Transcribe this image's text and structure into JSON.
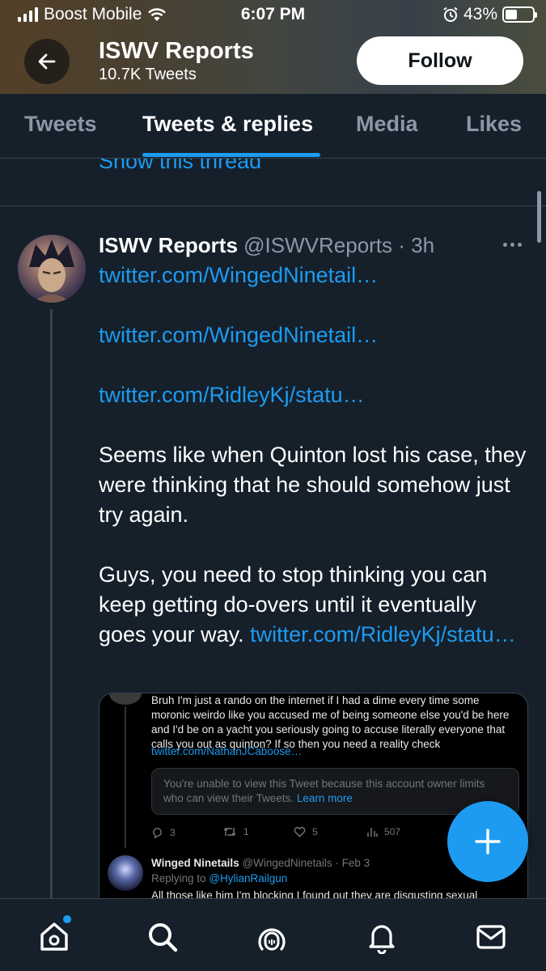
{
  "status_bar": {
    "carrier": "Boost Mobile",
    "time": "6:07 PM",
    "battery_percent": "43%",
    "battery_level": 0.43
  },
  "header": {
    "name": "ISWV Reports",
    "tweet_count": "10.7K Tweets",
    "follow_label": "Follow",
    "back_icon": "arrow-left-icon"
  },
  "tabs": [
    {
      "label": "Tweets",
      "active": false
    },
    {
      "label": "Tweets & replies",
      "active": true
    },
    {
      "label": "Media",
      "active": false
    },
    {
      "label": "Likes",
      "active": false
    }
  ],
  "timeline": {
    "show_thread": "Show this thread",
    "tweet": {
      "author": "ISWV Reports",
      "handle": "@ISWVReports",
      "separator": " · ",
      "time": "3h",
      "link1": "twitter.com/WingedNinetail…",
      "link2": "twitter.com/WingedNinetail…",
      "link3": "twitter.com/RidleyKj/statu…",
      "para1": "Seems like when Quinton lost his case, they were thinking that he should somehow just try again.",
      "para2": "Guys, you need to stop thinking you can keep getting do-overs until it eventually goes your way. ",
      "link4": "twitter.com/RidleyKj/statu…"
    },
    "embed": {
      "text": "Bruh I'm just a rando on the internet if I had a dime every time some moronic weirdo like you accused me of being someone else you'd be here and I'd be on a yacht you seriously going to accuse literally everyone that calls you out as quinton? If so then you need a reality check",
      "link": "twitter.com/NathanJCaboose…",
      "limited_text": "You're unable to view this Tweet because this account owner limits who can view their Tweets. ",
      "learn_more": "Learn more",
      "replies": "3",
      "retweets": "1",
      "likes": "5",
      "views": "507",
      "reply_author": "Winged Ninetails",
      "reply_handle": "@WingedNinetails · Feb 3",
      "replying_to_label": "Replying to ",
      "replying_to_handle": "@HylianRailgun",
      "reply_text": "All those like him I'm blocking I found out they are disgusting sexual"
    }
  },
  "bottom_nav": [
    "home-icon",
    "search-icon",
    "spaces-icon",
    "bell-icon",
    "mail-icon"
  ],
  "colors": {
    "background": "#15202b",
    "accent": "#1d9bf0",
    "muted": "#8b98a5",
    "border": "#38444d"
  }
}
